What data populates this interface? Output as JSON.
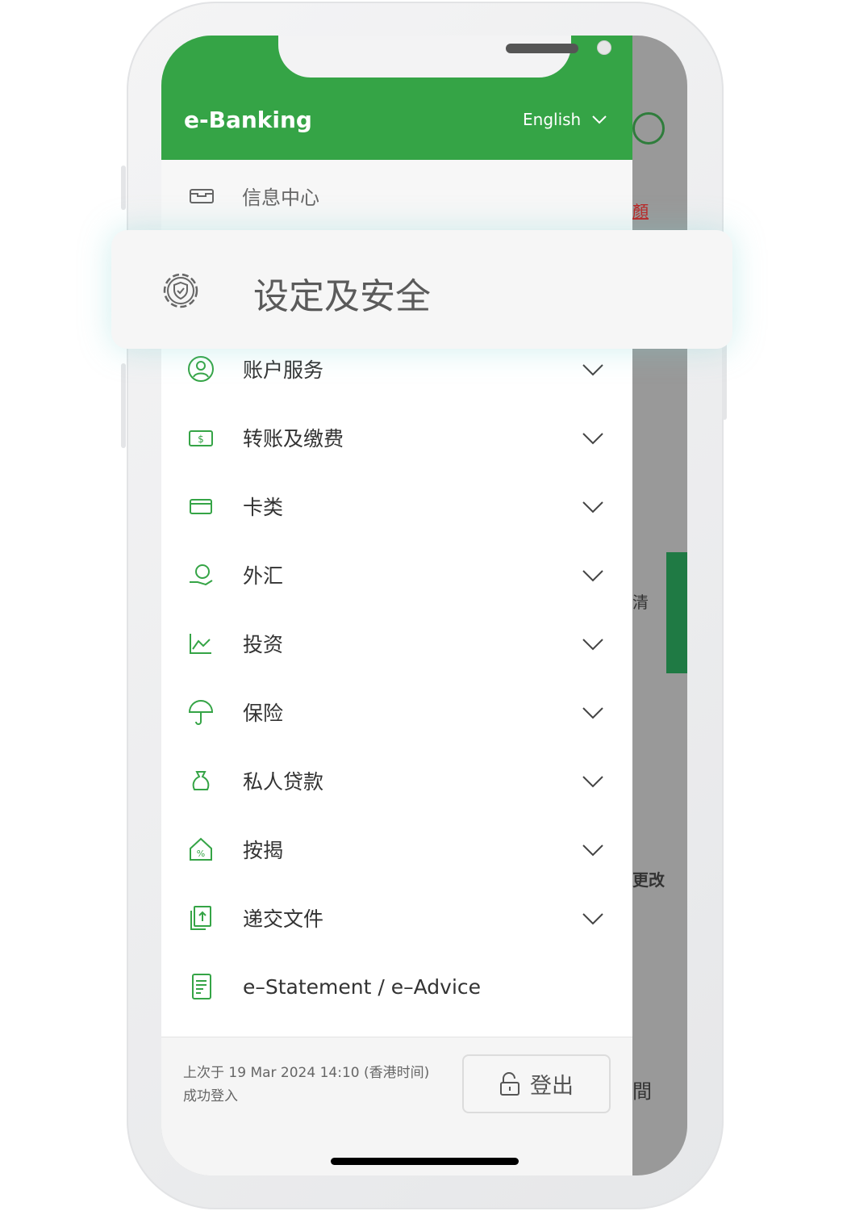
{
  "header": {
    "title": "e-Banking",
    "language": "English"
  },
  "message_center": {
    "label": "信息中心",
    "icon": "inbox-icon"
  },
  "highlighted": {
    "label": "设定及安全",
    "icon": "gear-shield-icon"
  },
  "menu": [
    {
      "label": "账户服务",
      "icon": "user-icon"
    },
    {
      "label": "转账及缴费",
      "icon": "transfer-icon"
    },
    {
      "label": "卡类",
      "icon": "card-icon"
    },
    {
      "label": "外汇",
      "icon": "fx-icon"
    },
    {
      "label": "投资",
      "icon": "chart-icon"
    },
    {
      "label": "保险",
      "icon": "umbrella-icon"
    },
    {
      "label": "私人贷款",
      "icon": "money-bag-icon"
    },
    {
      "label": "按揭",
      "icon": "house-percent-icon"
    },
    {
      "label": "递交文件",
      "icon": "upload-doc-icon"
    },
    {
      "label": "e–Statement / e–Advice",
      "icon": "document-icon"
    }
  ],
  "footer": {
    "last_login_line1": "上次于 19 Mar 2024 14:10 (香港时间)",
    "last_login_line2": "成功登入",
    "logout": "登出"
  },
  "background_fragments": [
    "顏",
    "清",
    "更改",
    "間"
  ],
  "colors": {
    "brand_green": "#35a446",
    "overlay": "#999999"
  }
}
